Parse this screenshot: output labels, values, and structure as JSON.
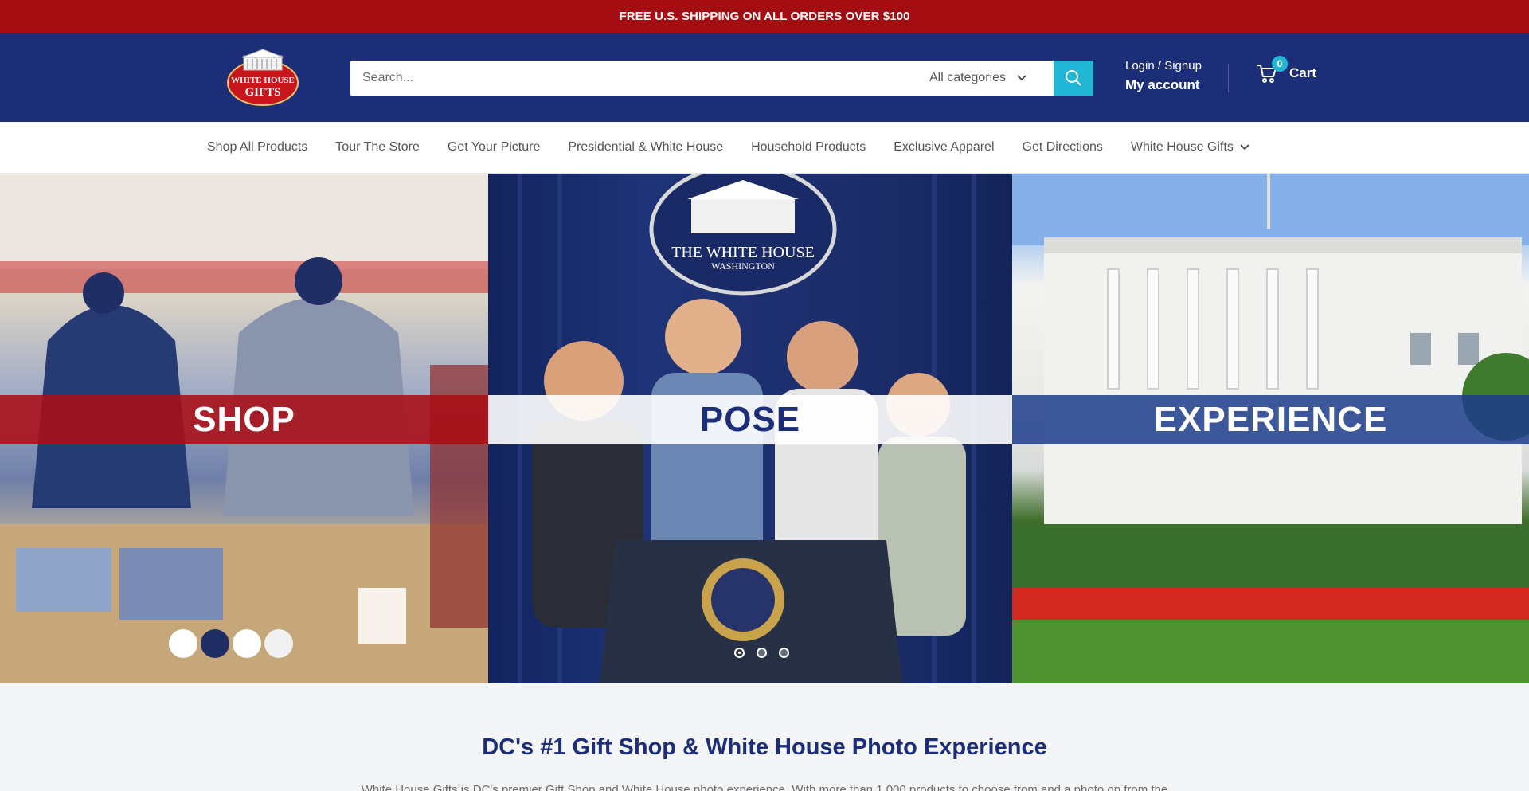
{
  "announcement": "FREE U.S. SHIPPING ON ALL ORDERS OVER $100",
  "header": {
    "logo_text": "WHITE HOUSE GIFTS",
    "search_placeholder": "Search...",
    "category_label": "All categories",
    "account_top": "Login / Signup",
    "account_bottom": "My account",
    "cart_label": "Cart",
    "cart_count": "0"
  },
  "nav": {
    "items": [
      "Shop All Products",
      "Tour The Store",
      "Get Your Picture",
      "Presidential & White House",
      "Household Products",
      "Exclusive Apparel",
      "Get Directions",
      "White House Gifts"
    ]
  },
  "hero": {
    "panels": [
      "SHOP",
      "POSE",
      "EXPERIENCE"
    ],
    "podium_text": "THE WHITE HOUSE",
    "podium_sub": "WASHINGTON"
  },
  "intro": {
    "title": "DC's #1 Gift Shop & White House Photo Experience",
    "text": "White House Gifts is DC's premier Gift Shop and White House photo experience. With more than 1,000 products to choose from and a photo op from the"
  },
  "colors": {
    "announcement_bg": "#a40e13",
    "header_bg": "#1d2e78",
    "accent": "#22b6d6"
  }
}
